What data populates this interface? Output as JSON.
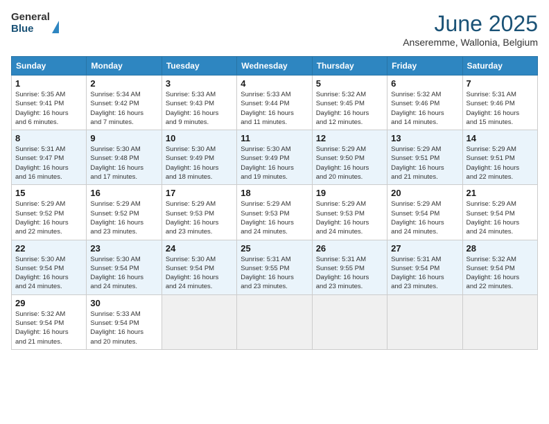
{
  "header": {
    "logo_line1": "General",
    "logo_line2": "Blue",
    "title": "June 2025",
    "subtitle": "Anseremme, Wallonia, Belgium"
  },
  "calendar": {
    "weekdays": [
      "Sunday",
      "Monday",
      "Tuesday",
      "Wednesday",
      "Thursday",
      "Friday",
      "Saturday"
    ],
    "weeks": [
      [
        {
          "day": "",
          "empty": true
        },
        {
          "day": "",
          "empty": true
        },
        {
          "day": "",
          "empty": true
        },
        {
          "day": "",
          "empty": true
        },
        {
          "day": "5",
          "info": "Sunrise: 5:32 AM\nSunset: 9:45 PM\nDaylight: 16 hours\nand 12 minutes."
        },
        {
          "day": "6",
          "info": "Sunrise: 5:32 AM\nSunset: 9:46 PM\nDaylight: 16 hours\nand 14 minutes."
        },
        {
          "day": "7",
          "info": "Sunrise: 5:31 AM\nSunset: 9:46 PM\nDaylight: 16 hours\nand 15 minutes."
        }
      ],
      [
        {
          "day": "1",
          "info": "Sunrise: 5:35 AM\nSunset: 9:41 PM\nDaylight: 16 hours\nand 6 minutes."
        },
        {
          "day": "2",
          "info": "Sunrise: 5:34 AM\nSunset: 9:42 PM\nDaylight: 16 hours\nand 7 minutes."
        },
        {
          "day": "3",
          "info": "Sunrise: 5:33 AM\nSunset: 9:43 PM\nDaylight: 16 hours\nand 9 minutes."
        },
        {
          "day": "4",
          "info": "Sunrise: 5:33 AM\nSunset: 9:44 PM\nDaylight: 16 hours\nand 11 minutes."
        },
        {
          "day": "5",
          "info": "Sunrise: 5:32 AM\nSunset: 9:45 PM\nDaylight: 16 hours\nand 12 minutes."
        },
        {
          "day": "6",
          "info": "Sunrise: 5:32 AM\nSunset: 9:46 PM\nDaylight: 16 hours\nand 14 minutes."
        },
        {
          "day": "7",
          "info": "Sunrise: 5:31 AM\nSunset: 9:46 PM\nDaylight: 16 hours\nand 15 minutes."
        }
      ],
      [
        {
          "day": "8",
          "info": "Sunrise: 5:31 AM\nSunset: 9:47 PM\nDaylight: 16 hours\nand 16 minutes."
        },
        {
          "day": "9",
          "info": "Sunrise: 5:30 AM\nSunset: 9:48 PM\nDaylight: 16 hours\nand 17 minutes."
        },
        {
          "day": "10",
          "info": "Sunrise: 5:30 AM\nSunset: 9:49 PM\nDaylight: 16 hours\nand 18 minutes."
        },
        {
          "day": "11",
          "info": "Sunrise: 5:30 AM\nSunset: 9:49 PM\nDaylight: 16 hours\nand 19 minutes."
        },
        {
          "day": "12",
          "info": "Sunrise: 5:29 AM\nSunset: 9:50 PM\nDaylight: 16 hours\nand 20 minutes."
        },
        {
          "day": "13",
          "info": "Sunrise: 5:29 AM\nSunset: 9:51 PM\nDaylight: 16 hours\nand 21 minutes."
        },
        {
          "day": "14",
          "info": "Sunrise: 5:29 AM\nSunset: 9:51 PM\nDaylight: 16 hours\nand 22 minutes."
        }
      ],
      [
        {
          "day": "15",
          "info": "Sunrise: 5:29 AM\nSunset: 9:52 PM\nDaylight: 16 hours\nand 22 minutes."
        },
        {
          "day": "16",
          "info": "Sunrise: 5:29 AM\nSunset: 9:52 PM\nDaylight: 16 hours\nand 23 minutes."
        },
        {
          "day": "17",
          "info": "Sunrise: 5:29 AM\nSunset: 9:53 PM\nDaylight: 16 hours\nand 23 minutes."
        },
        {
          "day": "18",
          "info": "Sunrise: 5:29 AM\nSunset: 9:53 PM\nDaylight: 16 hours\nand 24 minutes."
        },
        {
          "day": "19",
          "info": "Sunrise: 5:29 AM\nSunset: 9:53 PM\nDaylight: 16 hours\nand 24 minutes."
        },
        {
          "day": "20",
          "info": "Sunrise: 5:29 AM\nSunset: 9:54 PM\nDaylight: 16 hours\nand 24 minutes."
        },
        {
          "day": "21",
          "info": "Sunrise: 5:29 AM\nSunset: 9:54 PM\nDaylight: 16 hours\nand 24 minutes."
        }
      ],
      [
        {
          "day": "22",
          "info": "Sunrise: 5:30 AM\nSunset: 9:54 PM\nDaylight: 16 hours\nand 24 minutes."
        },
        {
          "day": "23",
          "info": "Sunrise: 5:30 AM\nSunset: 9:54 PM\nDaylight: 16 hours\nand 24 minutes."
        },
        {
          "day": "24",
          "info": "Sunrise: 5:30 AM\nSunset: 9:54 PM\nDaylight: 16 hours\nand 24 minutes."
        },
        {
          "day": "25",
          "info": "Sunrise: 5:31 AM\nSunset: 9:55 PM\nDaylight: 16 hours\nand 23 minutes."
        },
        {
          "day": "26",
          "info": "Sunrise: 5:31 AM\nSunset: 9:55 PM\nDaylight: 16 hours\nand 23 minutes."
        },
        {
          "day": "27",
          "info": "Sunrise: 5:31 AM\nSunset: 9:54 PM\nDaylight: 16 hours\nand 23 minutes."
        },
        {
          "day": "28",
          "info": "Sunrise: 5:32 AM\nSunset: 9:54 PM\nDaylight: 16 hours\nand 22 minutes."
        }
      ],
      [
        {
          "day": "29",
          "info": "Sunrise: 5:32 AM\nSunset: 9:54 PM\nDaylight: 16 hours\nand 21 minutes."
        },
        {
          "day": "30",
          "info": "Sunrise: 5:33 AM\nSunset: 9:54 PM\nDaylight: 16 hours\nand 20 minutes."
        },
        {
          "day": "",
          "empty": true
        },
        {
          "day": "",
          "empty": true
        },
        {
          "day": "",
          "empty": true
        },
        {
          "day": "",
          "empty": true
        },
        {
          "day": "",
          "empty": true
        }
      ]
    ]
  }
}
